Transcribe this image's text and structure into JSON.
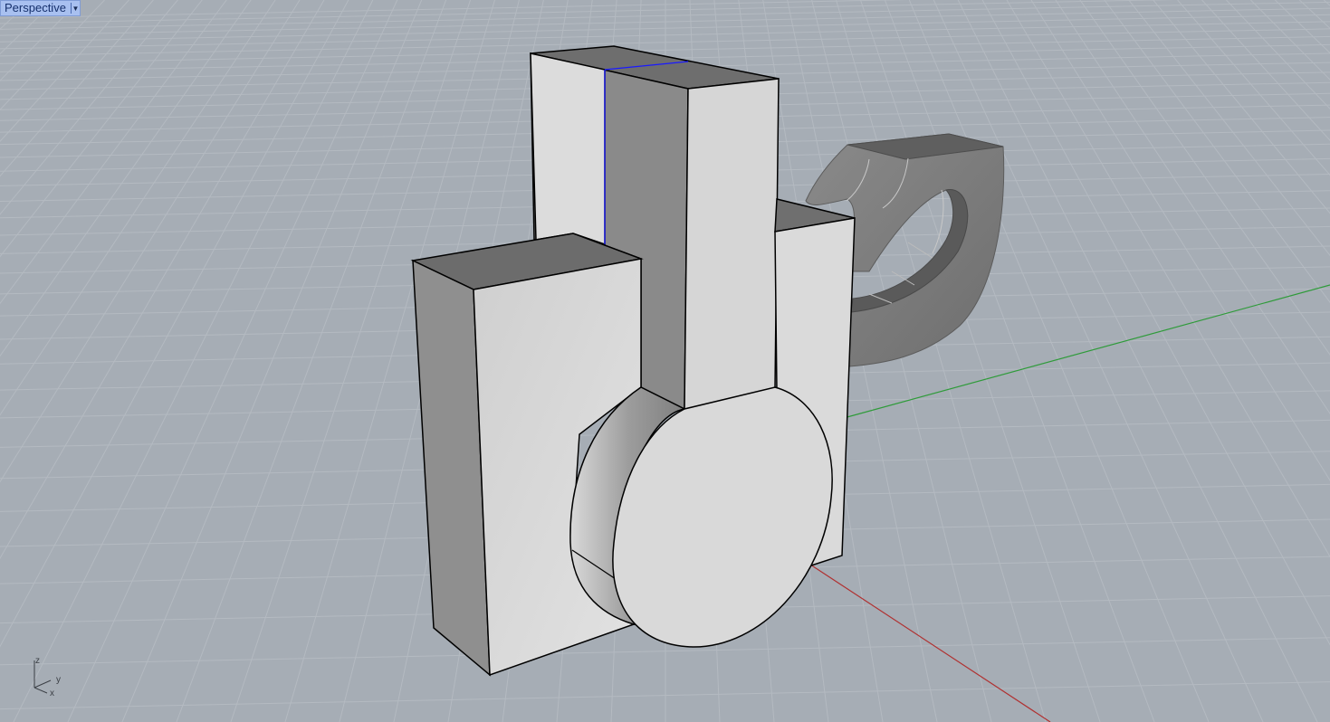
{
  "viewport": {
    "label": "Perspective",
    "menu_icon": "triangle-down-icon",
    "label_bg": "#a8c0f0"
  },
  "colors": {
    "background": "#a7aeb6",
    "grid_line": "#b6bcc3",
    "x_axis": "#b03030",
    "y_axis": "#2f9b3a",
    "selected_edge": "#1a1aff",
    "edge": "#000000"
  },
  "axis_icon": {
    "z": "z",
    "y": "y",
    "x": "x"
  }
}
